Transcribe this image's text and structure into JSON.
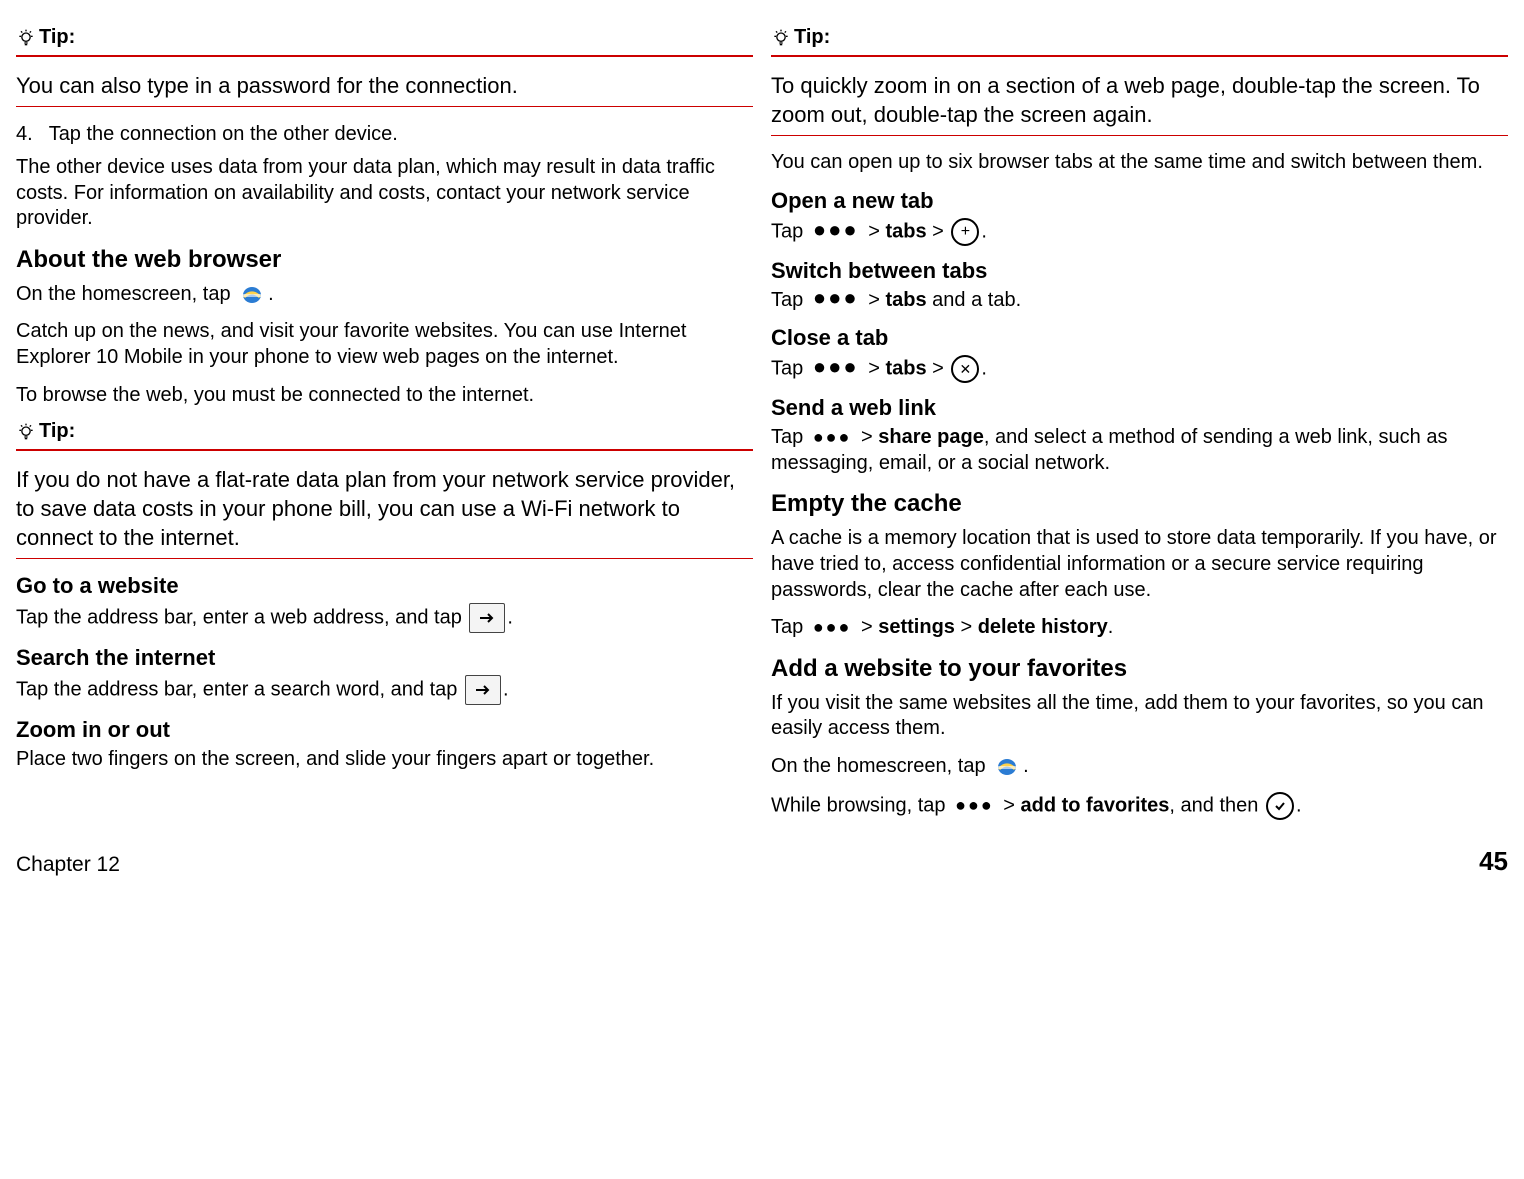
{
  "left": {
    "tip_label": "Tip:",
    "tip1_body": "You can also type in a password for the connection.",
    "step4_num": "4.",
    "step4_text": "Tap the connection on the other device.",
    "step4_after": "The other device uses data from your data plan, which may result in data traffic costs. For information on availability and costs, contact your network service provider.",
    "h_about": "About the web browser",
    "homescreen_prefix": "On the homescreen, tap ",
    "period": ".",
    "about_p2": "Catch up on the news, and visit your favorite websites. You can use Internet Explorer 10 Mobile in your phone to view web pages on the internet.",
    "about_p3": "To browse the web, you must be connected to the internet.",
    "tip2_body": "If you do not have a flat-rate data plan from your network service provider, to save data costs in your phone bill, you can use a Wi-Fi network to connect to the internet.",
    "h_goto": "Go to a website",
    "goto_prefix": "Tap the address bar, enter a web address, and tap ",
    "h_search": "Search the internet",
    "search_prefix": "Tap the address bar, enter a search word, and tap ",
    "h_zoom": "Zoom in or out",
    "zoom_body": "Place two fingers on the screen, and slide your fingers apart or together."
  },
  "right": {
    "tip_label": "Tip:",
    "tip_body": "To quickly zoom in on a section of a web page, double-tap the screen. To zoom out, double-tap the screen again.",
    "tabs_intro": "You can open up to six browser tabs at the same time and switch between them.",
    "h_open": "Open a new tab",
    "tap": "Tap ",
    "gt": " > ",
    "tabs_bold": "tabs",
    "h_switch": "Switch between tabs",
    "switch_suffix": " and a tab.",
    "h_close": "Close a tab",
    "h_send": "Send a web link",
    "share_bold": "share page",
    "send_suffix": ", and select a method of sending a web link, such as messaging, email, or a social network.",
    "h_empty": "Empty the cache",
    "empty_p": "A cache is a memory location that is used to store data temporarily. If you have, or have tried to, access confidential information or a secure service requiring passwords, clear the cache after each use.",
    "settings_bold": "settings",
    "delete_bold": "delete history",
    "h_fav": "Add a website to your favorites",
    "fav_p": "If you visit the same websites all the time, add them to your favorites, so you can easily access them.",
    "homescreen_prefix": "On the homescreen, tap ",
    "while_prefix": "While browsing, tap ",
    "addfav_bold": "add to favorites",
    "andthen": ", and then ",
    "period": "."
  },
  "footer": {
    "chapter": "Chapter 12",
    "page": "45"
  }
}
